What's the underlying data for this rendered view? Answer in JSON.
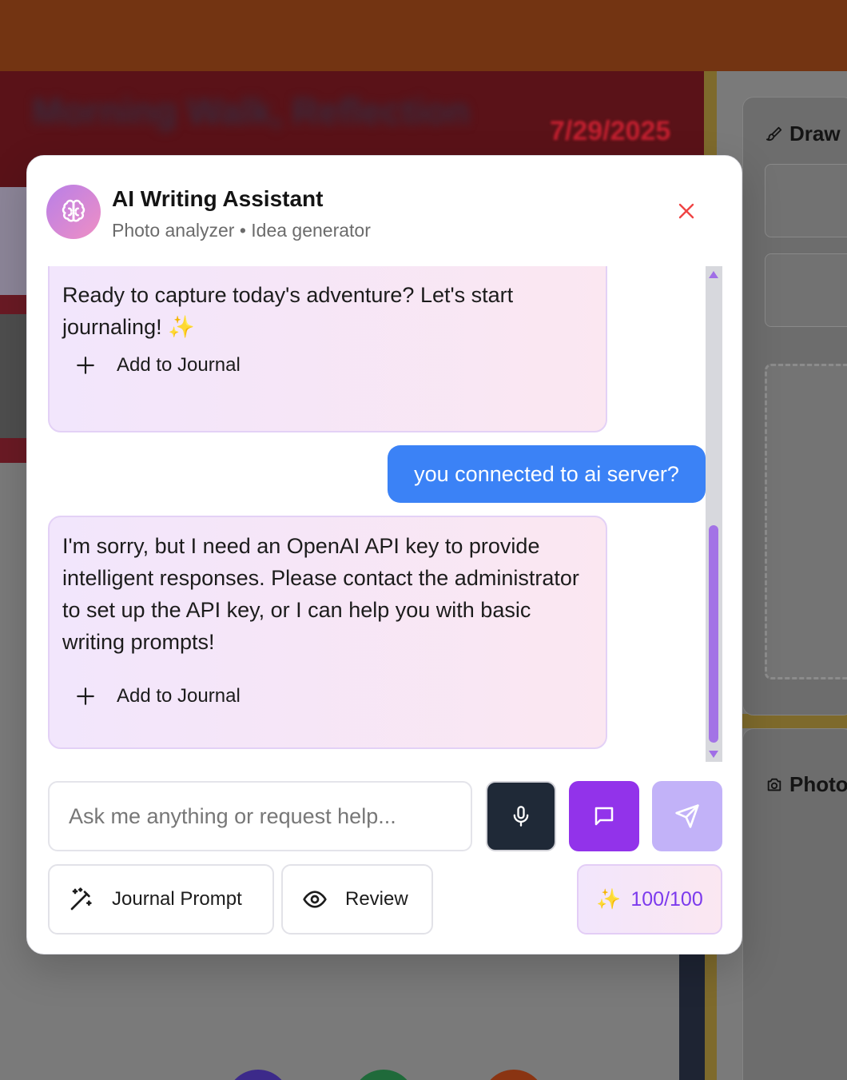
{
  "background": {
    "header_title": "Morning Walk, Reflection",
    "header_date": "7/29/2025",
    "draw_panel_title": "Draw",
    "photo_panel_title": "Photo"
  },
  "dialog": {
    "title": "AI Writing Assistant",
    "subtitle": "Photo analyzer • Idea generator",
    "icons": {
      "avatar": "brain-icon",
      "close": "close-icon"
    },
    "colors": {
      "user_bubble": "#3b82f6",
      "chat_button": "#9233ea",
      "mic_button": "#1f2937",
      "send_button": "#c2b2f8",
      "accent": "#7c3aed",
      "close": "#ef4444"
    }
  },
  "messages": [
    {
      "role": "assistant",
      "text": "Ready to capture today's adventure? Let's start journaling! ✨",
      "action_label": "Add to Journal"
    },
    {
      "role": "user",
      "text": "you connected to ai server?"
    },
    {
      "role": "assistant",
      "text": "I'm sorry, but I need an OpenAI API key to provide intelligent responses. Please contact the administrator to set up the API key, or I can help you with basic writing prompts!",
      "action_label": "Add to Journal"
    }
  ],
  "composer": {
    "placeholder": "Ask me anything or request help...",
    "value": "",
    "icons": {
      "mic": "microphone-icon",
      "chat": "message-square-icon",
      "send": "send-icon"
    }
  },
  "tools": {
    "journal_prompt_label": "Journal Prompt",
    "review_label": "Review",
    "credits_icon": "✨",
    "credits_label": "100/100"
  }
}
